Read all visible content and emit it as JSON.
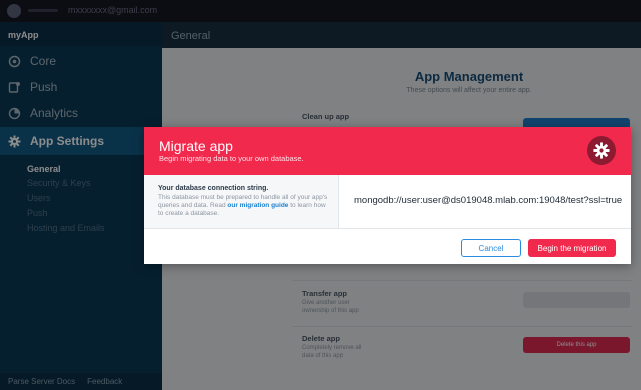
{
  "topbar": {
    "email": "mxxxxxxx@gmail.com"
  },
  "sidebar": {
    "app_name": "myApp",
    "items": [
      {
        "label": "Core",
        "icon": "core-icon"
      },
      {
        "label": "Push",
        "icon": "push-icon"
      },
      {
        "label": "Analytics",
        "icon": "analytics-icon"
      },
      {
        "label": "App Settings",
        "icon": "gear-icon"
      }
    ],
    "sub_items": [
      {
        "label": "General"
      },
      {
        "label": "Security & Keys"
      },
      {
        "label": "Users"
      },
      {
        "label": "Push"
      },
      {
        "label": "Hosting and Emails"
      }
    ],
    "footer": {
      "links": [
        "Parse Server Docs",
        "Feedback"
      ]
    }
  },
  "main": {
    "header": "General",
    "title": "App Management",
    "subtitle": "These options will affect your entire app.",
    "sections": [
      {
        "title": "Clean up app",
        "desc": ""
      },
      {
        "title": "Transfer app",
        "desc": "Give another user ownership of this app"
      },
      {
        "title": "Delete app",
        "desc": "Completely remove all data of this app"
      }
    ],
    "delete_button": "Delete this app"
  },
  "modal": {
    "title": "Migrate app",
    "subtitle": "Begin migrating data to your own database.",
    "conn_label": "Your database connection string.",
    "conn_desc": "This database must be prepared to handle all of your app's queries and data. Read ",
    "conn_link": "our migration guide",
    "conn_desc_end": " to learn how to create a database.",
    "conn_value": "mongodb://user:user@ds019048.mlab.com:19048/test?ssl=true",
    "cancel": "Cancel",
    "begin": "Begin the migration"
  },
  "colors": {
    "accent_red": "#f0294d",
    "sidebar_active": "#125c85",
    "link_blue": "#1a7fd0"
  }
}
